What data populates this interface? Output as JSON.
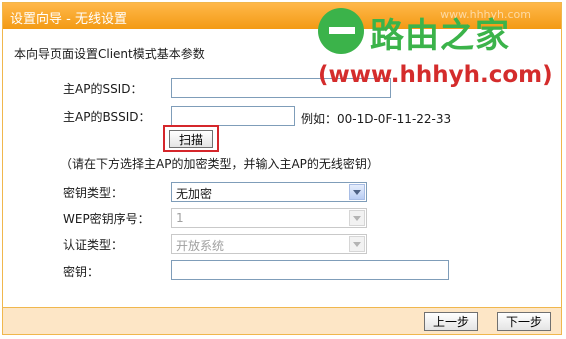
{
  "window": {
    "title": "设置向导 - 无线设置",
    "faint_title": "www.hhhyh.com"
  },
  "intro": "本向导页面设置Client模式基本参数",
  "fields": {
    "ssid_label": "主AP的SSID：",
    "bssid_label": "主AP的BSSID：",
    "bssid_example": "例如：00-1D-0F-11-22-33",
    "scan_button": "扫描",
    "hint": "（请在下方选择主AP的加密类型，并输入主AP的无线密钥）",
    "key_type_label": "密钥类型：",
    "key_type_value": "无加密",
    "wep_index_label": "WEP密钥序号：",
    "wep_index_value": "1",
    "auth_type_label": "认证类型：",
    "auth_type_value": "开放系统",
    "key_label": "密钥："
  },
  "footer": {
    "prev_button": "上一步",
    "next_button": "下一步"
  },
  "watermark": {
    "name": "路由之家",
    "url": "(www.hhhyh.com)"
  },
  "colors": {
    "title_bar": "#f6a323",
    "frame": "#f0b74d",
    "footer": "#fde6c6",
    "highlight": "#d5262b",
    "watermark_green": "#3bb34a",
    "watermark_red": "#d42c2c"
  }
}
